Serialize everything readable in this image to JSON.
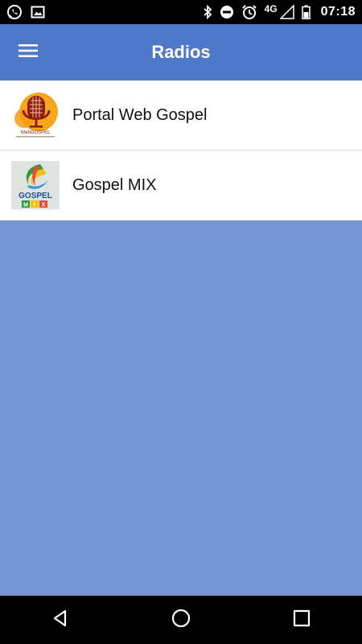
{
  "status_bar": {
    "network": "4G",
    "time": "07:18"
  },
  "app_bar": {
    "title": "Radios",
    "menu_icon": "hamburger-menu-icon"
  },
  "radios": [
    {
      "name": "Portal Web Gospel",
      "logo": "webgospel-microphone-logo",
      "logo_text": "WebGOSPEL"
    },
    {
      "name": "Gospel MIX",
      "logo": "gospel-mix-logo",
      "logo_text": "GOSPEL MIX"
    }
  ],
  "colors": {
    "app_bar": "#4f78cb",
    "background": "#7595d4",
    "list_background": "#ffffff"
  },
  "nav_bar": {
    "buttons": [
      "back-icon",
      "home-icon",
      "recents-icon"
    ]
  }
}
